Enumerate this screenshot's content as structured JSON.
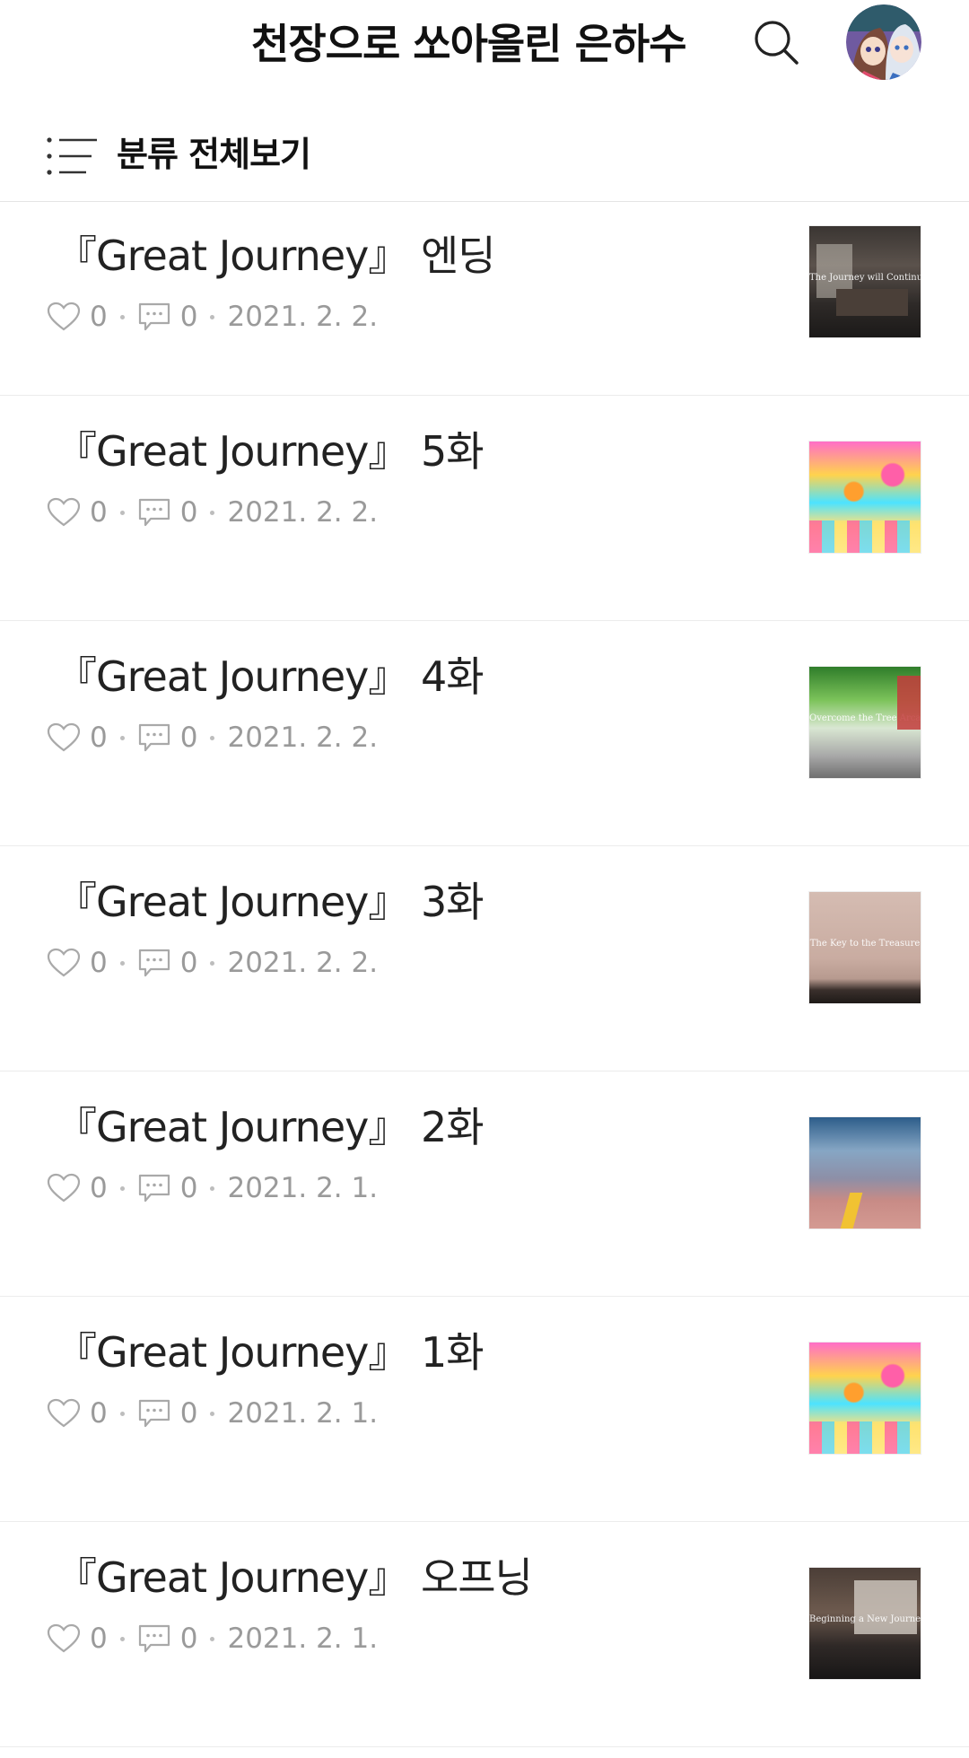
{
  "header": {
    "blog_title": "천장으로 쏘아올린 은하수"
  },
  "category": {
    "label": "분류 전체보기"
  },
  "posts": [
    {
      "title": "『Great Journey』 엔딩",
      "likes": "0",
      "comments": "0",
      "date": "2021. 2. 2.",
      "thumb_caption": "The Journey will Continue"
    },
    {
      "title": "『Great Journey』 5화",
      "likes": "0",
      "comments": "0",
      "date": "2021. 2. 2.",
      "thumb_caption": ""
    },
    {
      "title": "『Great Journey』 4화",
      "likes": "0",
      "comments": "0",
      "date": "2021. 2. 2.",
      "thumb_caption": "Overcome the Tree Arcana"
    },
    {
      "title": "『Great Journey』 3화",
      "likes": "0",
      "comments": "0",
      "date": "2021. 2. 2.",
      "thumb_caption": "The Key to the Treasure"
    },
    {
      "title": "『Great Journey』 2화",
      "likes": "0",
      "comments": "0",
      "date": "2021. 2. 1.",
      "thumb_caption": ""
    },
    {
      "title": "『Great Journey』 1화",
      "likes": "0",
      "comments": "0",
      "date": "2021. 2. 1.",
      "thumb_caption": ""
    },
    {
      "title": "『Great Journey』 오프닝",
      "likes": "0",
      "comments": "0",
      "date": "2021. 2. 1.",
      "thumb_caption": "Beginning a New Journey"
    }
  ],
  "icons": {
    "search": "search-icon",
    "avatar": "avatar",
    "category": "list-icon",
    "like": "heart-icon",
    "comment": "comment-icon"
  },
  "colors": {
    "text": "#222222",
    "meta": "#9a9a9a",
    "divider": "#ececec"
  }
}
